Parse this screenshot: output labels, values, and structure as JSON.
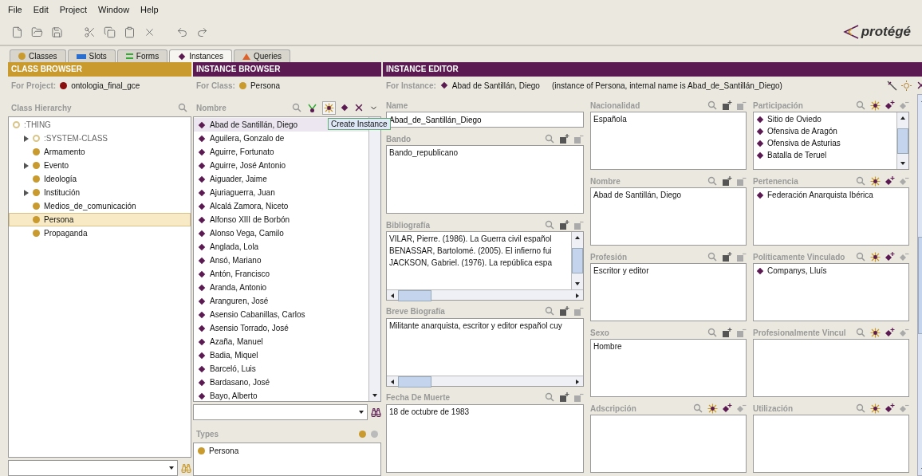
{
  "menu": [
    "File",
    "Edit",
    "Project",
    "Window",
    "Help"
  ],
  "logo": "protégé",
  "tabs": [
    {
      "label": "Classes",
      "kind": "classes",
      "selected": false
    },
    {
      "label": "Slots",
      "kind": "slots",
      "selected": false
    },
    {
      "label": "Forms",
      "kind": "forms",
      "selected": false
    },
    {
      "label": "Instances",
      "kind": "instances",
      "selected": true
    },
    {
      "label": "Queries",
      "kind": "queries",
      "selected": false
    }
  ],
  "class_browser": {
    "title": "CLASS BROWSER",
    "project_label": "For Project:",
    "project": "ontologia_final_gce",
    "hierarchy_label": "Class Hierarchy",
    "tree": [
      {
        "label": ":THING",
        "kind": "system",
        "selected": false,
        "children": [
          {
            "label": ":SYSTEM-CLASS",
            "kind": "system",
            "selected": false,
            "expanded": false
          },
          {
            "label": "Armamento",
            "kind": "class",
            "selected": false
          },
          {
            "label": "Evento",
            "kind": "class",
            "selected": false,
            "expanded": false
          },
          {
            "label": "Ideología",
            "kind": "class",
            "selected": false
          },
          {
            "label": "Institución",
            "kind": "class",
            "selected": false,
            "expanded": false
          },
          {
            "label": "Medios_de_comunicación",
            "kind": "class",
            "selected": false
          },
          {
            "label": "Persona",
            "kind": "class",
            "selected": true
          },
          {
            "label": "Propaganda",
            "kind": "class",
            "selected": false
          }
        ]
      }
    ]
  },
  "instance_browser": {
    "title": "INSTANCE BROWSER",
    "class_label": "For Class:",
    "class_name": "Persona",
    "column": "Nombre",
    "tooltip": "Create Instance",
    "instances": [
      {
        "label": "Abad de Santillán, Diego",
        "selected": true
      },
      {
        "label": "Aguilera, Gonzalo de",
        "selected": false
      },
      {
        "label": "Aguirre, Fortunato",
        "selected": false
      },
      {
        "label": "Aguirre, José Antonio",
        "selected": false
      },
      {
        "label": "Aiguader, Jaime",
        "selected": false
      },
      {
        "label": "Ajuriaguerra, Juan",
        "selected": false
      },
      {
        "label": "Alcalá Zamora, Niceto",
        "selected": false
      },
      {
        "label": "Alfonso XIII de Borbón",
        "selected": false
      },
      {
        "label": "Alonso Vega, Camilo",
        "selected": false
      },
      {
        "label": "Anglada, Lola",
        "selected": false
      },
      {
        "label": "Ansó, Mariano",
        "selected": false
      },
      {
        "label": "Antón, Francisco",
        "selected": false
      },
      {
        "label": "Aranda, Antonio",
        "selected": false
      },
      {
        "label": "Aranguren, José",
        "selected": false
      },
      {
        "label": "Asensio Cabanillas, Carlos",
        "selected": false
      },
      {
        "label": "Asensio Torrado, José",
        "selected": false
      },
      {
        "label": "Azaña, Manuel",
        "selected": false
      },
      {
        "label": "Badia, Miquel",
        "selected": false
      },
      {
        "label": "Barceló, Luis",
        "selected": false
      },
      {
        "label": "Bardasano, José",
        "selected": false
      },
      {
        "label": "Bayo, Alberto",
        "selected": false
      }
    ],
    "types_label": "Types",
    "types": [
      "Persona"
    ]
  },
  "instance_editor": {
    "title": "INSTANCE EDITOR",
    "instance_label": "For Instance:",
    "instance_name": "Abad de Santillán, Diego",
    "instance_note": "(instance of Persona, internal name is Abad_de_Santillán_Diego)",
    "columns": [
      [
        {
          "label": "Name",
          "kind": "name",
          "values": [
            "Abad_de_Santillán_Diego"
          ]
        },
        {
          "label": "Bando",
          "kind": "values",
          "values": [
            "Bando_republicano"
          ]
        },
        {
          "label": "Bibliografía",
          "kind": "values",
          "vertical_scrollbar": true,
          "horizontal_scrollbar": true,
          "values": [
            "VILAR, Pierre. (1986). La Guerra civil español",
            "BENASSAR, Bartolomé. (2005). El infierno fui",
            "JACKSON, Gabriel. (1976). La república espa"
          ]
        },
        {
          "label": "Breve Biografía",
          "kind": "values",
          "horizontal_scrollbar": true,
          "values": [
            "Militante anarquista, escritor y editor español cuy"
          ]
        },
        {
          "label": "Fecha De Muerte",
          "kind": "values",
          "values": [
            "18 de octubre de 1983"
          ]
        }
      ],
      [
        {
          "label": "Nacionalidad",
          "kind": "values",
          "values": [
            "Española"
          ]
        },
        {
          "label": "Nombre",
          "kind": "values",
          "values": [
            "Abad de Santillán, Diego"
          ]
        },
        {
          "label": "Profesión",
          "kind": "values",
          "values": [
            "Escritor y editor"
          ]
        },
        {
          "label": "Sexo",
          "kind": "values",
          "values": [
            "Hombre"
          ]
        },
        {
          "label": "Adscripción",
          "kind": "instances"
        }
      ],
      [
        {
          "label": "Participación",
          "kind": "instances",
          "vertical_scrollbar": true,
          "values": [
            "Sitio de Oviedo",
            "Ofensiva de Aragón",
            "Ofensiva de Asturias",
            "Batalla de Teruel"
          ]
        },
        {
          "label": "Pertenencia",
          "kind": "instances",
          "values": [
            "Federación Anarquista Ibérica"
          ]
        },
        {
          "label": "Politicamente Vinculado",
          "kind": "instances",
          "values": [
            "Companys, Lluís"
          ]
        },
        {
          "label": "Profesionalmente Vincul",
          "kind": "instances"
        },
        {
          "label": "Utilización",
          "kind": "instances"
        }
      ]
    ]
  }
}
